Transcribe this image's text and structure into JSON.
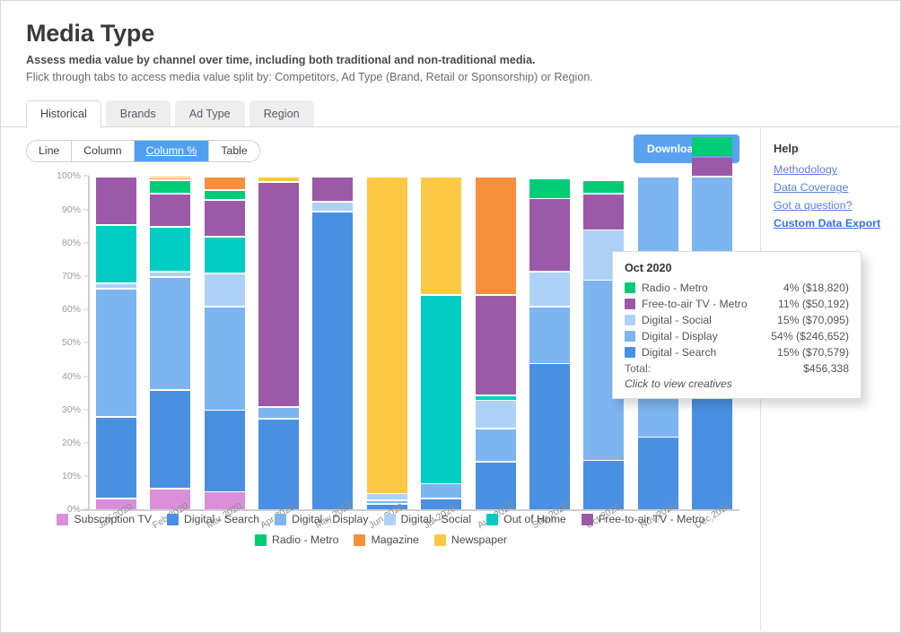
{
  "header": {
    "title": "Media Type",
    "subtitle_bold": "Assess media value by channel over time, including both traditional and non-traditional media.",
    "subtitle_light": "Flick through tabs to access media value split by: Competitors, Ad Type (Brand, Retail or Sponsorship) or Region."
  },
  "tabs": [
    {
      "label": "Historical",
      "active": true
    },
    {
      "label": "Brands",
      "active": false
    },
    {
      "label": "Ad Type",
      "active": false
    },
    {
      "label": "Region",
      "active": false
    }
  ],
  "toolbar": {
    "view_modes": [
      {
        "label": "Line",
        "active": false
      },
      {
        "label": "Column",
        "active": false
      },
      {
        "label": "Column %",
        "active": true
      },
      {
        "label": "Table",
        "active": false
      }
    ],
    "download_label": "Download CSV"
  },
  "help": {
    "title": "Help",
    "links": [
      {
        "label": "Methodology",
        "strong": false
      },
      {
        "label": "Data Coverage",
        "strong": false
      },
      {
        "label": "Got a question?",
        "strong": false
      },
      {
        "label": "Custom Data Export",
        "strong": true
      }
    ]
  },
  "colors": {
    "subscription_tv": "#d98fd9",
    "digital_search": "#4a90e2",
    "digital_display": "#7db5f0",
    "digital_social": "#aed2f7",
    "out_of_home": "#00ccc4",
    "free_to_air_tv_metro": "#9b59a8",
    "radio_metro": "#00cc77",
    "magazine": "#f7903d",
    "newspaper": "#fdc844",
    "accent_blue": "#5aa2f0",
    "link_blue": "#5a7fe0"
  },
  "tooltip": {
    "title": "Oct 2020",
    "rows": [
      {
        "name": "Radio - Metro",
        "value": "4% ($18,820)",
        "color": "#00cc77"
      },
      {
        "name": "Free-to-air TV - Metro",
        "value": "11% ($50,192)",
        "color": "#9b59a8"
      },
      {
        "name": "Digital - Social",
        "value": "15% ($70,095)",
        "color": "#aed2f7"
      },
      {
        "name": "Digital - Display",
        "value": "54% ($246,652)",
        "color": "#7db5f0"
      },
      {
        "name": "Digital - Search",
        "value": "15% ($70,579)",
        "color": "#4a90e2"
      }
    ],
    "total_label": "Total:",
    "total_value": "$456,338",
    "note": "Click to view creatives"
  },
  "chart_data": {
    "type": "bar",
    "stacked": true,
    "normalized": true,
    "title": "",
    "xlabel": "",
    "ylabel": "",
    "ylim": [
      0,
      100
    ],
    "grid": false,
    "legend_position": "bottom",
    "y_ticks": [
      "0%",
      "10%",
      "20%",
      "30%",
      "40%",
      "50%",
      "60%",
      "70%",
      "80%",
      "90%",
      "100%"
    ],
    "categories": [
      "Jan 2020",
      "Feb 2020",
      "Mar 2020",
      "Apr 2020",
      "May 2020",
      "Jun 2020",
      "Jul 2020",
      "Aug 2020",
      "Sep 2020",
      "Oct 2020",
      "Nov 2020",
      "Dec 2020"
    ],
    "series": [
      {
        "name": "Subscription TV",
        "color": "#d98fd9",
        "values": [
          3.5,
          6.5,
          5.5,
          0,
          0,
          0,
          0,
          0,
          0,
          0,
          0,
          0
        ]
      },
      {
        "name": "Digital - Search",
        "color": "#4a90e2",
        "values": [
          24.5,
          29.5,
          24.5,
          27.5,
          89.5,
          2.0,
          3.5,
          14.5,
          44.0,
          15.0,
          22.0,
          52.0
        ]
      },
      {
        "name": "Digital - Display",
        "color": "#7db5f0",
        "values": [
          38.5,
          34.0,
          31.0,
          3.5,
          0,
          1.0,
          4.5,
          10.0,
          17.0,
          54.0,
          78.0,
          48.0
        ]
      },
      {
        "name": "Digital - Social",
        "color": "#aed2f7",
        "values": [
          1.5,
          1.5,
          10.0,
          0,
          3.0,
          2.0,
          0,
          8.5,
          10.5,
          15.0,
          0,
          0
        ]
      },
      {
        "name": "Out of Home",
        "color": "#00ccc4",
        "values": [
          17.5,
          13.5,
          11.0,
          0,
          0,
          0,
          56.5,
          1.5,
          0,
          0,
          0,
          0
        ]
      },
      {
        "name": "Free-to-air TV - Metro",
        "color": "#9b59a8",
        "values": [
          14.5,
          10.0,
          11.0,
          67.5,
          7.5,
          0,
          0,
          30.0,
          22.0,
          11.0,
          0,
          6.0
        ]
      },
      {
        "name": "Radio - Metro",
        "color": "#00cc77",
        "values": [
          0,
          4.0,
          3.0,
          0,
          0,
          0,
          0,
          0,
          6.0,
          4.0,
          0,
          6.0
        ]
      },
      {
        "name": "Magazine",
        "color": "#f7903d",
        "values": [
          0,
          0.5,
          4.0,
          0,
          0,
          0,
          0,
          35.5,
          0,
          0,
          0,
          0
        ]
      },
      {
        "name": "Newspaper",
        "color": "#fdc844",
        "values": [
          0,
          0.5,
          0,
          1.5,
          0,
          95.0,
          35.5,
          0,
          0,
          0,
          0,
          0
        ]
      }
    ],
    "legend_rows": [
      [
        "Subscription TV",
        "Digital - Search",
        "Digital - Display",
        "Digital - Social",
        "Out of Home",
        "Free-to-air TV - Metro"
      ],
      [
        "Radio - Metro",
        "Magazine",
        "Newspaper"
      ]
    ]
  }
}
